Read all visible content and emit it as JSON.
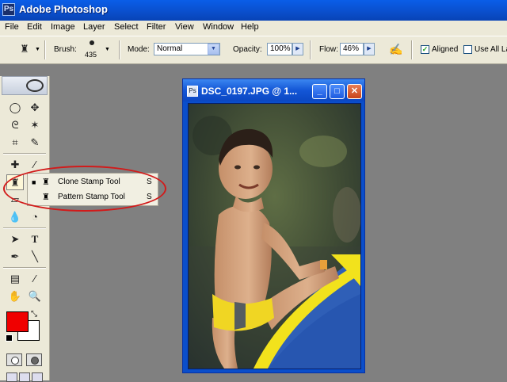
{
  "window": {
    "title": "Adobe Photoshop",
    "icon": "photoshop-app-icon"
  },
  "menubar": {
    "items": [
      "File",
      "Edit",
      "Image",
      "Layer",
      "Select",
      "Filter",
      "View",
      "Window",
      "Help"
    ]
  },
  "options": {
    "brush_label": "Brush:",
    "brush_size": "435",
    "mode_label": "Mode:",
    "mode_value": "Normal",
    "opacity_label": "Opacity:",
    "opacity_value": "100%",
    "flow_label": "Flow:",
    "flow_value": "46%",
    "aligned_label": "Aligned",
    "aligned_checked": true,
    "use_all_layers_label": "Use All Layers",
    "use_all_layers_checked": false
  },
  "toolbox": {
    "selected_tool": "clone-stamp",
    "foreground_color": "#f00000",
    "background_color": "#ffffff"
  },
  "flyout": {
    "items": [
      {
        "name": "Clone Stamp Tool",
        "shortcut": "S",
        "active": true
      },
      {
        "name": "Pattern Stamp Tool",
        "shortcut": "S",
        "active": false
      }
    ],
    "highlight_color": "#d21a1a"
  },
  "document": {
    "title": "DSC_0197.JPG @ 1...",
    "icon": "document-icon"
  }
}
